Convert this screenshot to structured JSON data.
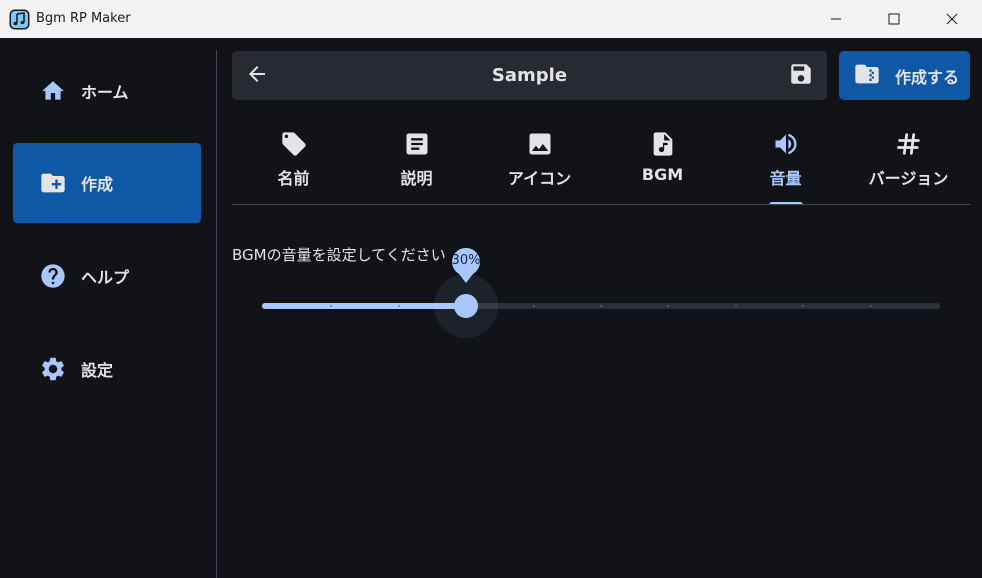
{
  "window": {
    "title": "Bgm RP Maker"
  },
  "sidebar": {
    "items": [
      {
        "label": "ホーム",
        "icon": "home-icon"
      },
      {
        "label": "作成",
        "icon": "create-folder-icon",
        "active": true
      },
      {
        "label": "ヘルプ",
        "icon": "help-icon"
      },
      {
        "label": "設定",
        "icon": "settings-icon"
      }
    ]
  },
  "header": {
    "title": "Sample",
    "back_icon": "arrow-back-icon",
    "save_icon": "save-icon"
  },
  "create_button": {
    "label": "作成する",
    "icon": "folder-zip-icon"
  },
  "tabs": [
    {
      "label": "名前",
      "icon": "tag-icon"
    },
    {
      "label": "説明",
      "icon": "description-icon"
    },
    {
      "label": "アイコン",
      "icon": "image-icon"
    },
    {
      "label": "BGM",
      "icon": "audio-file-icon"
    },
    {
      "label": "音量",
      "icon": "volume-icon",
      "active": true
    },
    {
      "label": "バージョン",
      "icon": "hash-icon"
    }
  ],
  "volume": {
    "label": "BGMの音量を設定してください",
    "value_text": "30%",
    "value": 30,
    "min": 0,
    "max": 100,
    "divisions": 10
  },
  "colors": {
    "background": "#111318",
    "accent": "#0f58a6",
    "primary": "#a9c7ff",
    "surface": "#272a30"
  }
}
